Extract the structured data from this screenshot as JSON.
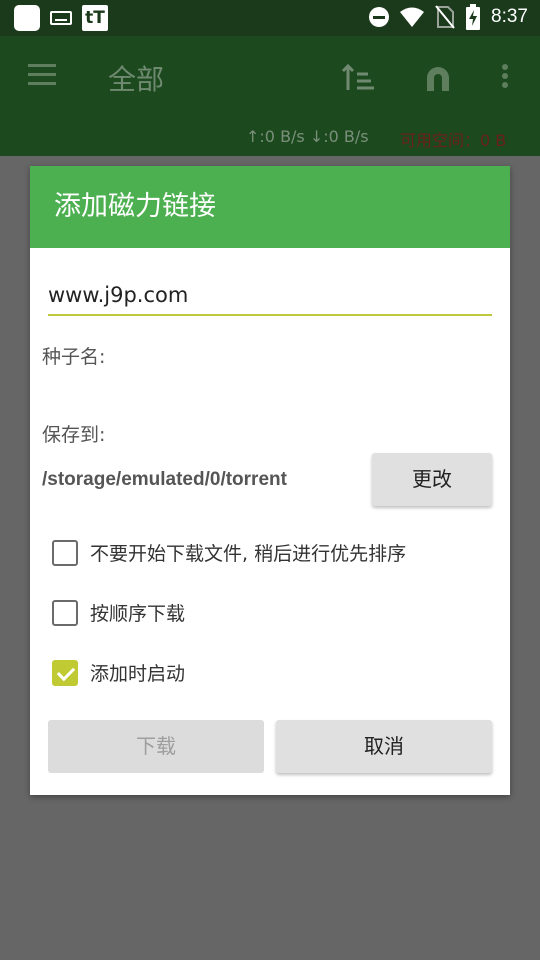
{
  "status_bar": {
    "time": "8:37",
    "left_icons": [
      "app-square-icon",
      "keyboard-icon",
      "tt-app-icon"
    ],
    "tt_label": "tT",
    "right_icons": [
      "do-not-disturb-icon",
      "wifi-icon",
      "no-sim-icon",
      "battery-charging-icon"
    ]
  },
  "toolbar": {
    "title": "全部",
    "speed": "↑:0 B/s ↓:0 B/s",
    "free_space": "可用空间：0 B",
    "icons": [
      "menu-icon",
      "sort-icon",
      "magnet-icon",
      "more-vert-icon"
    ]
  },
  "dialog": {
    "title": "添加磁力链接",
    "url_value": "www.j9p.com",
    "torrent_name_label": "种子名:",
    "save_to_label": "保存到:",
    "save_path": "/storage/emulated/0/torrent",
    "change_button": "更改",
    "checkboxes": [
      {
        "label": "不要开始下载文件, 稍后进行优先排序",
        "checked": false
      },
      {
        "label": "按顺序下载",
        "checked": false
      },
      {
        "label": "添加时启动",
        "checked": true
      }
    ],
    "download_button": "下载",
    "cancel_button": "取消"
  },
  "colors": {
    "header_green": "#4caf50",
    "checkbox_accent": "#c0ca33",
    "toolbar_dimmed": "#1c4a1e",
    "scrim": "#666666"
  }
}
